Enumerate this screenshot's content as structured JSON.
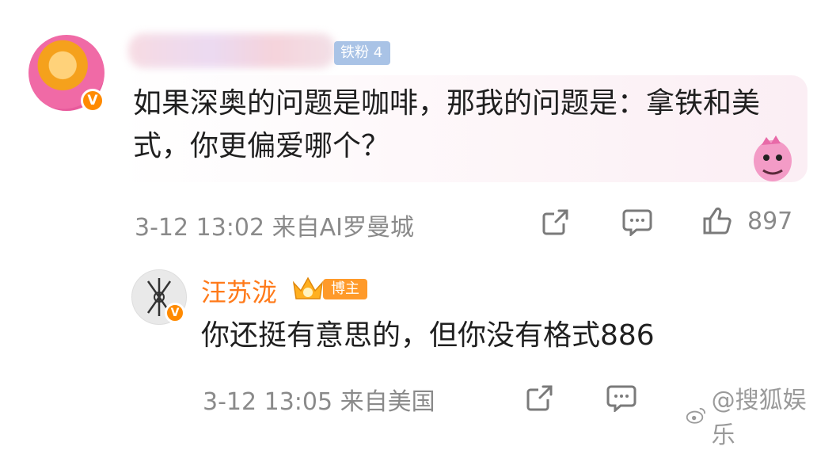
{
  "comment1": {
    "badge": "铁粉 4",
    "text": "如果深奥的问题是咖啡，那我的问题是：拿铁和美式，你更偏爱哪个？",
    "meta": "3-12 13:02  来自AI罗曼城",
    "likes": "897",
    "icons": [
      "share-icon",
      "comment-icon",
      "thumbs-up-icon"
    ]
  },
  "reply": {
    "username": "汪苏泷",
    "badge": "博主",
    "text": "你还挺有意思的，但你没有格式886",
    "meta": "3-12 13:05  来自美国",
    "icons": [
      "share-icon",
      "comment-icon"
    ]
  },
  "watermark": "@搜狐娱乐",
  "colors": {
    "accent_orange": "#ff7a1a",
    "verified_badge": "#ff8a00",
    "fan_badge": "#a9c3e6",
    "meta_gray": "#8a8a8a"
  }
}
